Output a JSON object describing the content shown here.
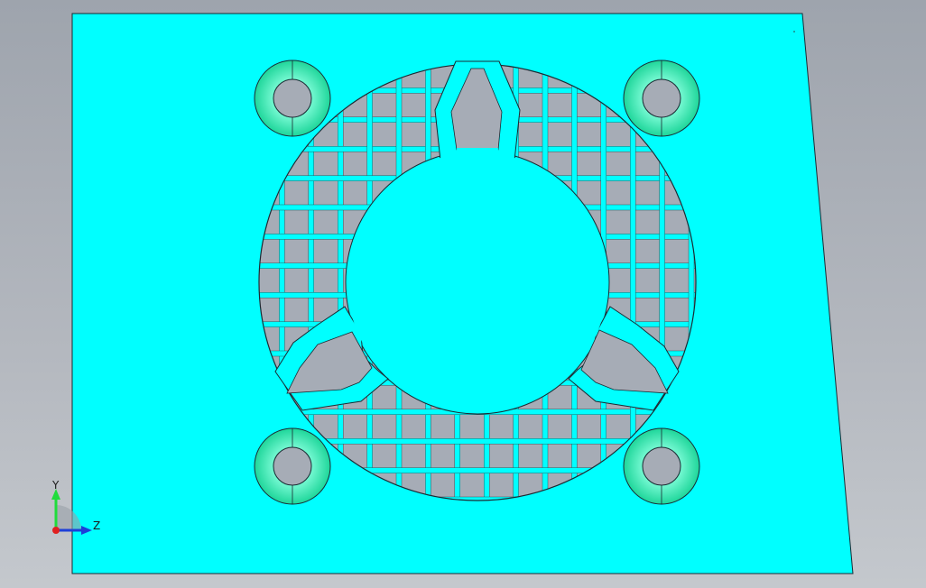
{
  "viewport": {
    "background_top": "#9ea4ad",
    "background_bottom": "#c4c8cd"
  },
  "part": {
    "face_color": "#00ffff",
    "edge_color": "#1b2a33",
    "hole_color": "#a6acb6",
    "boss_color": "#23e6a6"
  },
  "triad": {
    "y_label": "Y",
    "z_label": "Z",
    "y_color": "#1fdc3c",
    "z_color": "#1d3fd8",
    "x_color": "#e02020"
  }
}
